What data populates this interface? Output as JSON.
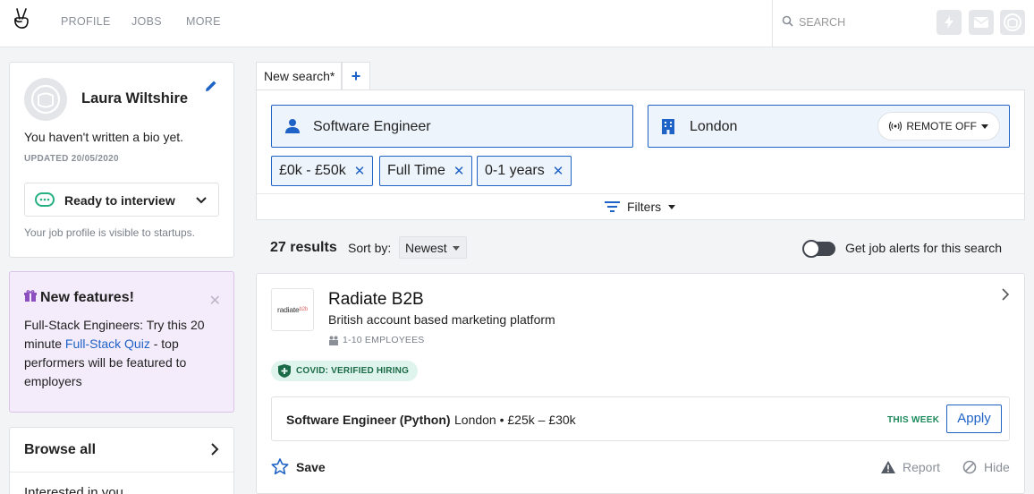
{
  "nav": {
    "links": [
      "PROFILE",
      "JOBS",
      "MORE"
    ],
    "search_placeholder": "SEARCH"
  },
  "profile": {
    "name": "Laura Wiltshire",
    "bio": "You haven't written a bio yet.",
    "updated": "UPDATED 20/05/2020",
    "status": "Ready to interview",
    "visibility_note": "Your job profile is visible to startups."
  },
  "features": {
    "title": "New features!",
    "body_before": "Full-Stack Engineers: Try this 20 minute ",
    "link_text": "Full-Stack Quiz",
    "body_after": " - top performers will be featured to employers"
  },
  "sidebar": {
    "browse_all": "Browse all",
    "interested": "Interested in you"
  },
  "search": {
    "tab_label": "New search*",
    "role": "Software Engineer",
    "location": "London",
    "remote_label": "REMOTE OFF",
    "chips": [
      "£0k - £50k",
      "Full Time",
      "0-1 years"
    ],
    "filters_label": "Filters"
  },
  "results": {
    "count_label": "27 results",
    "sort_label": "Sort by:",
    "sort_value": "Newest",
    "alerts_label": "Get job alerts for this search"
  },
  "company": {
    "logo_text": "radiate",
    "logo_suffix": "b2b",
    "name": "Radiate B2B",
    "description": "British account based marketing platform",
    "size": "1-10 EMPLOYEES",
    "covid_badge": "COVID: VERIFIED HIRING",
    "job": {
      "title": "Software Engineer (Python)",
      "meta": "London • £25k – £30k",
      "posted": "THIS WEEK",
      "apply_label": "Apply"
    },
    "save_label": "Save",
    "report_label": "Report",
    "hide_label": "Hide"
  },
  "colors": {
    "accent": "#1f63c6",
    "covid_green": "#1c6b48",
    "feature_bg": "#f5ecfb"
  }
}
